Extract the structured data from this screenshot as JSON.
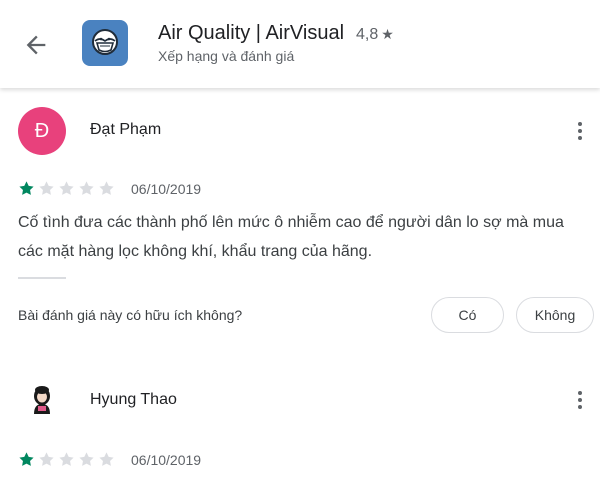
{
  "header": {
    "app_name": "Air Quality | AirVisual",
    "rating": "4,8",
    "rating_star": "★",
    "subtitle": "Xếp hạng và đánh giá"
  },
  "colors": {
    "star_filled": "#01875f",
    "star_empty": "#dadce0",
    "avatar_dat": "#e8417c",
    "app_icon_bg": "#4a82c0"
  },
  "reviews": [
    {
      "avatar_letter": "Đ",
      "author": "Đạt Phạm",
      "stars": 1,
      "date": "06/10/2019",
      "text": "Cố tình đưa các thành phố lên mức ô nhiễm cao để người dân lo sợ mà mua các mặt hàng lọc không khí, khẩu trang của hãng.",
      "helpful_question": "Bài đánh giá này có hữu ích không?",
      "yes_label": "Có",
      "no_label": "Không"
    },
    {
      "author": "Hyung Thao",
      "stars": 1,
      "date": "06/10/2019"
    }
  ]
}
